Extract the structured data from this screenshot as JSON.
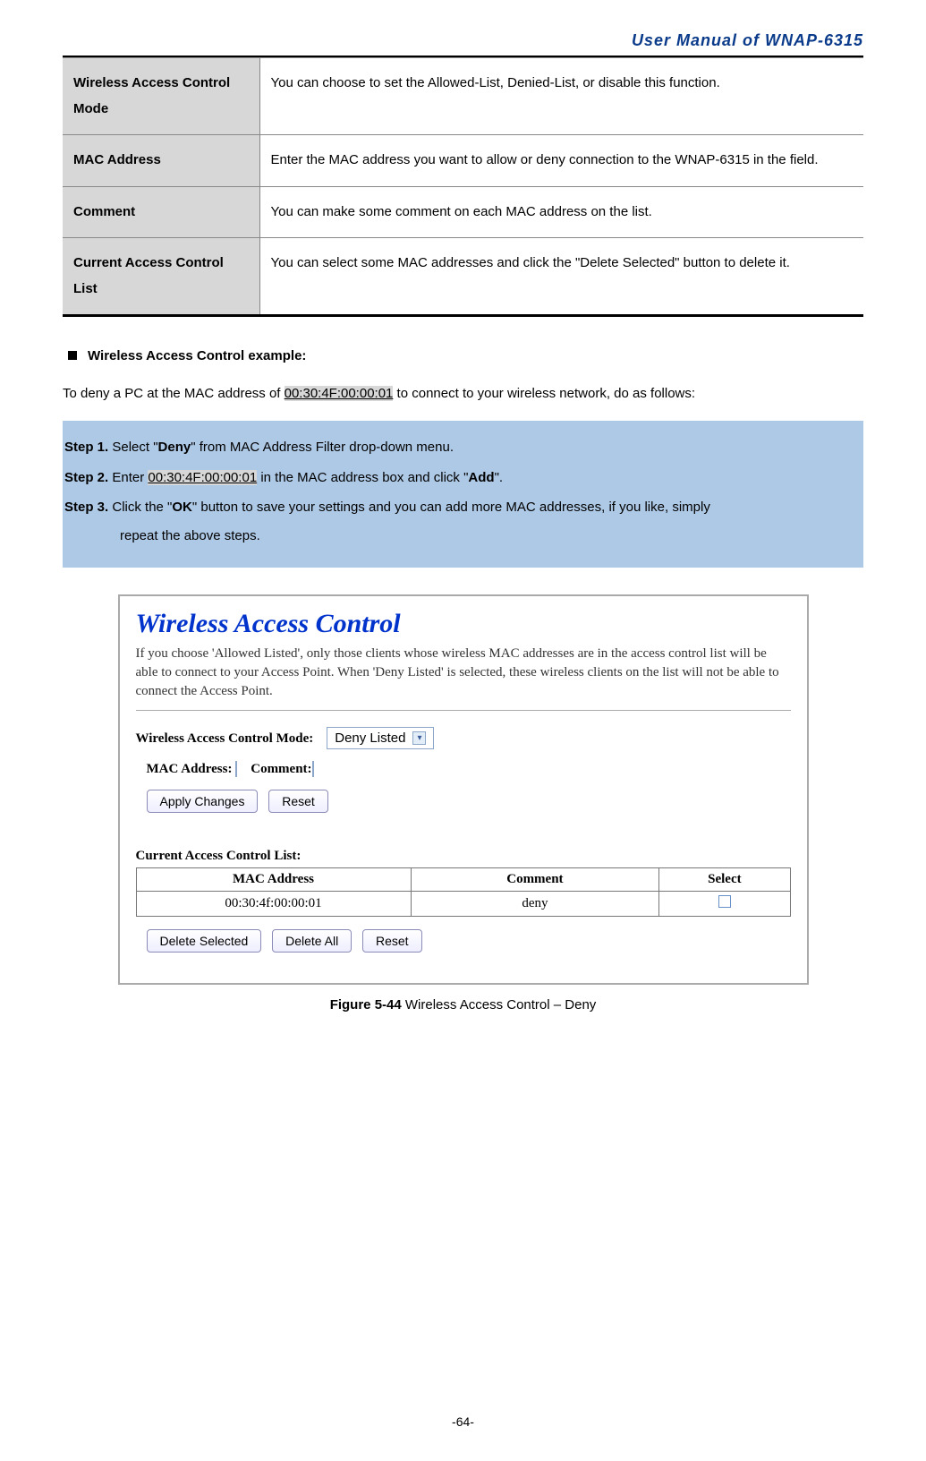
{
  "header": {
    "title": "User Manual of WNAP-6315"
  },
  "defs": {
    "rows": [
      {
        "term": "Wireless Access Control Mode",
        "desc": "You can choose to set the Allowed-List, Denied-List, or disable this function."
      },
      {
        "term": "MAC Address",
        "desc": "Enter the MAC address you want to allow or deny connection to the WNAP-6315 in the field."
      },
      {
        "term": "Comment",
        "desc": "You can make some comment on each MAC address on the list."
      },
      {
        "term": "Current Access Control List",
        "desc": "You can select some MAC addresses and click the \"Delete Selected\" button to delete it."
      }
    ]
  },
  "example": {
    "heading": "Wireless Access Control example:",
    "intro_pre": "To deny a PC at the MAC address of ",
    "intro_mac": "00:30:4F:00:00:01",
    "intro_post": " to connect to your wireless network, do as follows:",
    "steps": {
      "s1_label": "Step 1.",
      "s1_pre": "Select \"",
      "s1_b": "Deny",
      "s1_post": "\" from MAC Address Filter drop-down menu.",
      "s2_label": "Step 2.",
      "s2_pre": "Enter ",
      "s2_mac": "00:30:4F:00:00:01",
      "s2_mid": " in the MAC address box and click \"",
      "s2_b": "Add",
      "s2_post": "\".",
      "s3_label": "Step 3.",
      "s3_pre": "Click the \"",
      "s3_b": "OK",
      "s3_post": "\" button to save your settings and you can add more MAC addresses, if you like, simply",
      "s3_line2": "repeat the above steps."
    }
  },
  "screenshot": {
    "title": "Wireless Access Control",
    "intro": "If you choose 'Allowed Listed', only those clients whose wireless MAC addresses are in the access control list will be able to connect to your Access Point. When 'Deny Listed' is selected, these wireless clients on the list will not be able to connect the Access Point.",
    "mode_label": "Wireless Access Control Mode:",
    "mode_value": "Deny Listed",
    "mac_label": "MAC Address:",
    "comment_label": "Comment:",
    "btn_apply": "Apply Changes",
    "btn_reset": "Reset",
    "list_heading": "Current Access Control List:",
    "cols": {
      "c1": "MAC Address",
      "c2": "Comment",
      "c3": "Select"
    },
    "row": {
      "mac": "00:30:4f:00:00:01",
      "comment": "deny"
    },
    "btn_delsel": "Delete Selected",
    "btn_delall": "Delete All",
    "btn_reset2": "Reset"
  },
  "caption": {
    "bold": "Figure 5-44",
    "rest": " Wireless Access Control – Deny"
  },
  "footer": {
    "page": "-64-"
  }
}
